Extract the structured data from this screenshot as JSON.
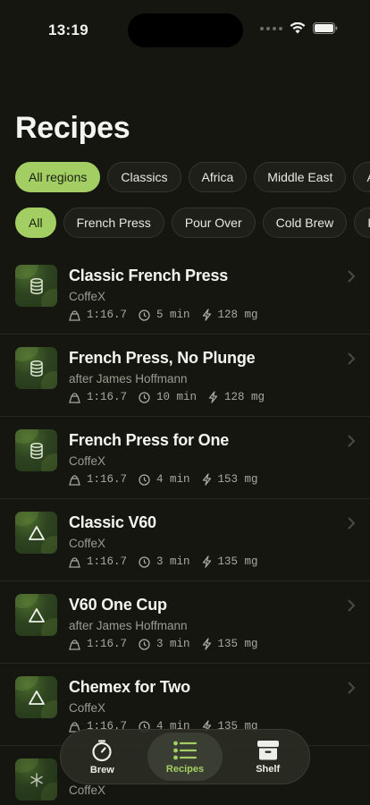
{
  "status": {
    "time": "13:19"
  },
  "title": "Recipes",
  "regions": [
    "All regions",
    "Classics",
    "Africa",
    "Middle East",
    "Asia"
  ],
  "methods": [
    "All",
    "French Press",
    "Pour Over",
    "Cold Brew",
    "Iced Co"
  ],
  "recipes": [
    {
      "title": "Classic French Press",
      "author": "CoffeX",
      "ratio": "1:16.7",
      "time": "5 min",
      "caffeine": "128 mg",
      "icon": "french-press-icon"
    },
    {
      "title": "French Press, No Plunge",
      "author": "after James Hoffmann",
      "ratio": "1:16.7",
      "time": "10 min",
      "caffeine": "128 mg",
      "icon": "french-press-icon"
    },
    {
      "title": "French Press for One",
      "author": "CoffeX",
      "ratio": "1:16.7",
      "time": "4 min",
      "caffeine": "153 mg",
      "icon": "french-press-icon"
    },
    {
      "title": "Classic V60",
      "author": "CoffeX",
      "ratio": "1:16.7",
      "time": "3 min",
      "caffeine": "135 mg",
      "icon": "pour-over-icon"
    },
    {
      "title": "V60 One Cup",
      "author": "after James Hoffmann",
      "ratio": "1:16.7",
      "time": "3 min",
      "caffeine": "135 mg",
      "icon": "pour-over-icon"
    },
    {
      "title": "Chemex for Two",
      "author": "CoffeX",
      "ratio": "1:16.7",
      "time": "4 min",
      "caffeine": "135 mg",
      "icon": "pour-over-icon"
    }
  ],
  "peek": {
    "author": "CoffeX",
    "icon": "snowflake-icon"
  },
  "tabs": [
    {
      "label": "Brew",
      "icon": "timer-icon"
    },
    {
      "label": "Recipes",
      "icon": "list-icon"
    },
    {
      "label": "Shelf",
      "icon": "archive-icon"
    }
  ],
  "colors": {
    "accent": "#A3CE63",
    "background": "#151610"
  }
}
